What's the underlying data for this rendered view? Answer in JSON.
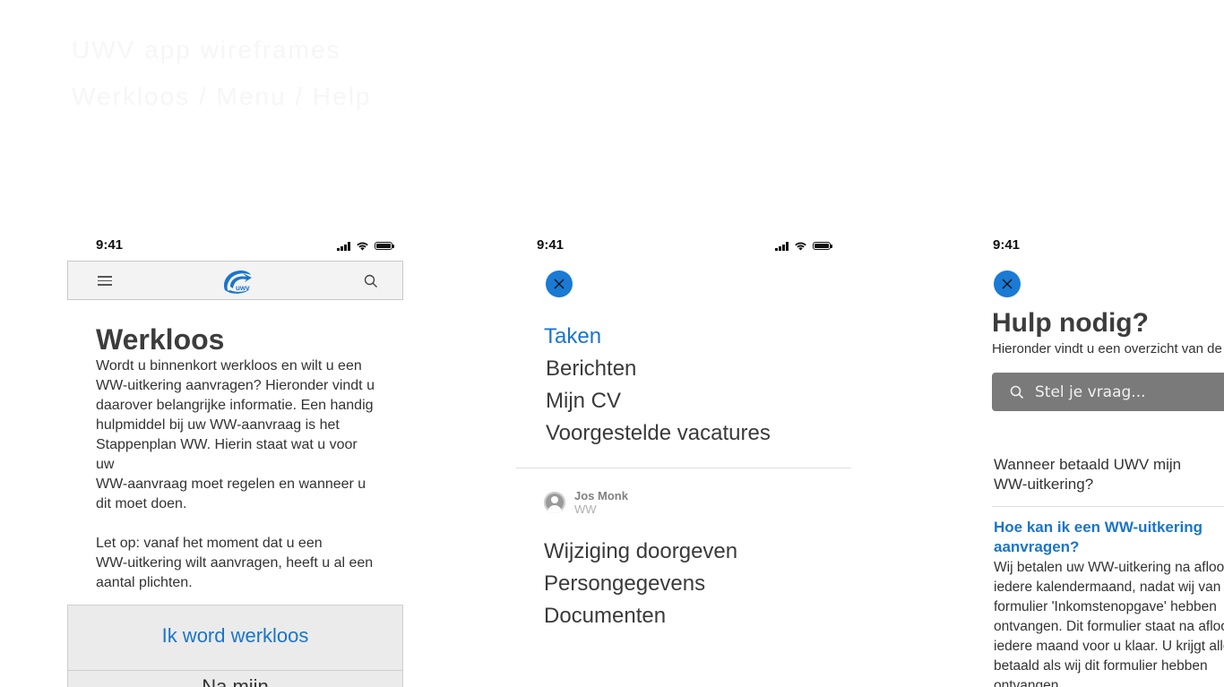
{
  "background_ghost_text": [
    "UWV app wireframes",
    "Werkloos / Menu / Help"
  ],
  "status_bar": {
    "time": "9:41"
  },
  "screen1": {
    "title": "Werkloos",
    "body": "Wordt u binnenkort werkloos en wilt u een\nWW-uitkering aanvragen? Hieronder vindt u\ndaarover belangrijke informatie. Een handig\nhulpmiddel bij uw WW-aanvraag is het\nStappenplan WW. Hierin staat wat u voor\nuw\nWW-aanvraag moet regelen en wanneer u\ndit moet doen.\n\nLet op: vanaf het moment dat u een\nWW-uitkering wilt aanvragen, heeft u al een\naantal plichten.",
    "primary_button": "Ik word werkloos",
    "secondary_button": "Na mijn",
    "logo_text": "uwv"
  },
  "screen2": {
    "menu_top": [
      "Taken",
      "Berichten",
      "Mijn CV",
      "Voorgestelde vacatures"
    ],
    "active_item": "Taken",
    "user": {
      "name": "Jos Monk",
      "role": "WW"
    },
    "menu_bottom": [
      "Wijziging doorgeven",
      "Persongegevens",
      "Documenten"
    ]
  },
  "screen3": {
    "title": "Hulp nodig?",
    "subtitle": "Hieronder vindt u een overzicht van de",
    "search_placeholder": "Stel je vraag...",
    "faq1": "Wanneer betaald UWV mijn WW-uitkering?",
    "faq2_title": "Hoe kan ik een WW-uitkering aanvragen?",
    "faq2_body": "Wij betalen uw WW-uitkering na afloop\niedere kalendermaand, nadat wij van u\nformulier 'Inkomstenopgave' hebben\nontvangen. Dit formulier staat na afloo\niedere maand voor u klaar. U krijgt alle\nbetaald als wij dit formulier hebben\nontvangen."
  },
  "colors": {
    "accent": "#1a75c9",
    "close_button": "#1a7ad4",
    "search_bg": "#7a7a7a"
  }
}
